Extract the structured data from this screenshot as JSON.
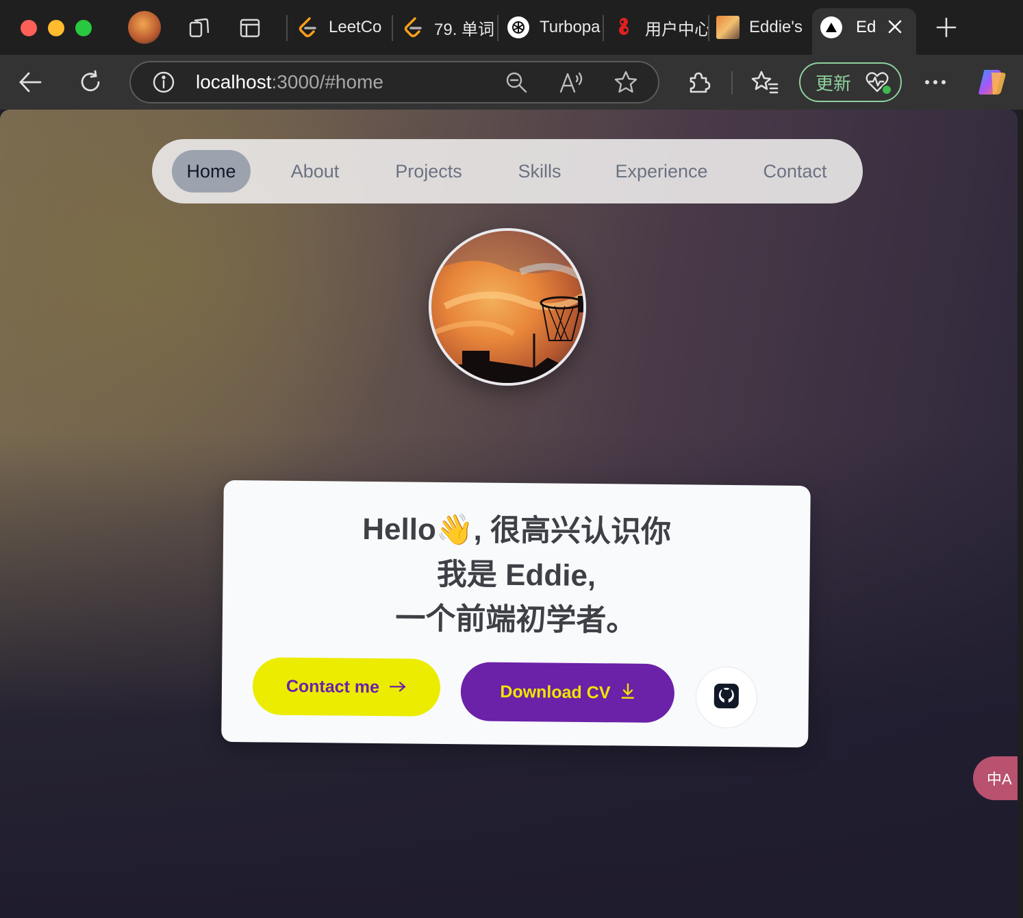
{
  "tabs": [
    {
      "label": "LeetCo",
      "icon": "leetcode-icon"
    },
    {
      "label": "79. 单词",
      "icon": "leetcode-icon"
    },
    {
      "label": "Turbopa",
      "icon": "openai-icon"
    },
    {
      "label": "用户中心",
      "icon": "red-logo-icon"
    },
    {
      "label": "Eddie's",
      "icon": "sunset-image-icon"
    },
    {
      "label": "Ed",
      "icon": "vercel-triangle-icon",
      "active": true
    }
  ],
  "address_bar": {
    "url_host": "localhost",
    "url_rest": ":3000/#home"
  },
  "toolbar": {
    "update_label": "更新"
  },
  "nav": {
    "items": [
      "Home",
      "About",
      "Projects",
      "Skills",
      "Experience",
      "Contact"
    ],
    "active": "Home"
  },
  "hero": {
    "line1": "Hello👋, 很高兴认识你",
    "line2": "我是 Eddie,",
    "line3": "一个前端初学者。",
    "contact_label": "Contact me",
    "download_label": "Download CV"
  },
  "translate_fab": {
    "label": "中A"
  },
  "colors": {
    "contact_bg": "#ecec00",
    "download_bg": "#6b21a8",
    "nav_active_bg": "#9ca3af",
    "update_green": "#8fd19e"
  }
}
